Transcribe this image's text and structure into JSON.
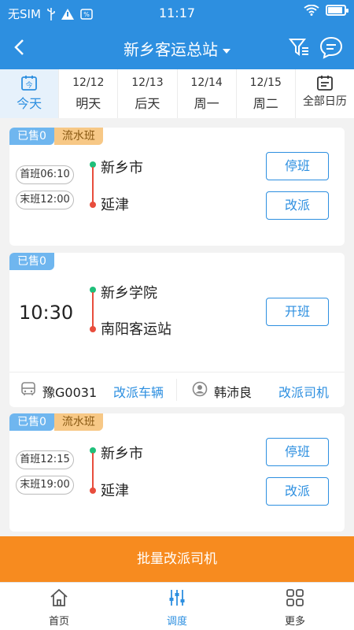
{
  "status_bar": {
    "carrier": "无SIM",
    "time": "11:17"
  },
  "nav": {
    "title": "新乡客运总站"
  },
  "dates": [
    {
      "date": "",
      "label": "今天",
      "active": true
    },
    {
      "date": "12/12",
      "label": "明天"
    },
    {
      "date": "12/13",
      "label": "后天"
    },
    {
      "date": "12/14",
      "label": "周一"
    },
    {
      "date": "12/15",
      "label": "周二"
    },
    {
      "date": "",
      "label": "全部日历"
    }
  ],
  "cards": [
    {
      "sold": "已售0",
      "type": "流水班",
      "first": "首班06:10",
      "last": "末班12:00",
      "from": "新乡市",
      "to": "延津",
      "btn1": "停班",
      "btn2": "改派"
    },
    {
      "sold": "已售0",
      "time": "10:30",
      "from": "新乡学院",
      "to": "南阳客运站",
      "btn1": "开班",
      "plate": "豫G0031",
      "change_vehicle": "改派车辆",
      "driver": "韩沛良",
      "change_driver": "改派司机"
    },
    {
      "sold": "已售0",
      "type": "流水班",
      "first": "首班12:15",
      "last": "末班19:00",
      "from": "新乡市",
      "to": "延津",
      "btn1": "停班",
      "btn2": "改派"
    }
  ],
  "batch_button": "批量改派司机",
  "tabs": [
    {
      "label": "首页",
      "icon": "home-icon"
    },
    {
      "label": "调度",
      "icon": "sliders-icon",
      "active": true
    },
    {
      "label": "更多",
      "icon": "grid-icon"
    }
  ],
  "colors": {
    "primary": "#2d8fe0",
    "accent": "#f78b1f",
    "green": "#1fbf7a",
    "red": "#e84d3d"
  }
}
